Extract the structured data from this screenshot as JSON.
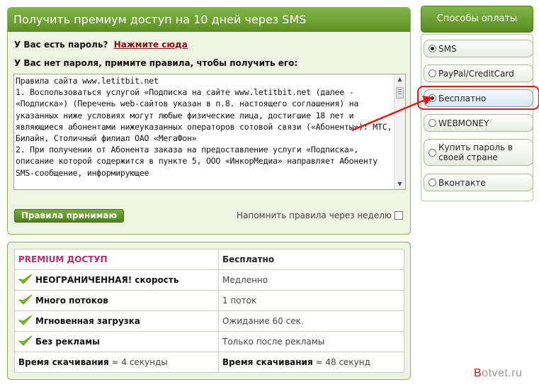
{
  "sms_panel": {
    "title": "Получить премиум доступ на 10 дней через SMS",
    "have_password": "У Вас есть пароль?",
    "click_here": "Нажмите сюда",
    "no_password": "У Вас нет пароля, примите правила, чтобы получить его:",
    "rules_text": "Правила сайта www.letitbit.net\n1. Воспользоваться услугой «Подписка на сайте www.letitbit.net (далее - «Подписка») (Перечень web-сайтов указан в п.8. настоящего соглашения) на указанных ниже условиях могут любые физические лица, достигшие 18 лет и являющиеся абонентами нижеуказанных операторов сотовой связи («Абоненты»): МТС, Билайн, Столичный филиал ОАО «МегаФон»\n2. При получении от Абонента заказа на предоставление услуги «Подписка», описание которой содержится в пункте 5, ООО «ИнкорМедиа» направляет Абоненту SMS-сообщение, информирующее",
    "accept_button": "Правила принимаю",
    "remind_label": "Напомнить правила через неделю"
  },
  "compare_table": {
    "premium_header": "PREMIUM ДОСТУП",
    "free_header": "Бесплатно",
    "rows": [
      {
        "premium": "НЕОГРАНИЧЕННАЯ! скорость",
        "free": "Медленно"
      },
      {
        "premium": "Много потоков",
        "free": "1 поток"
      },
      {
        "premium": "Мгновенная загрузка",
        "free": "Ожидание 60 сек."
      },
      {
        "premium": "Без рекламы",
        "free": "Только после рекламы"
      }
    ],
    "download_label": "Время скачивания",
    "premium_time": "≈ 4 секунды",
    "free_time": "≈ 48 секунд"
  },
  "payment": {
    "header": "Способы оплаты",
    "options": [
      {
        "label": "SMS",
        "selected": false
      },
      {
        "label": "PayPal/CreditCard",
        "selected": false
      },
      {
        "label": "Бесплатно",
        "selected": true
      },
      {
        "label": "WEBMONEY",
        "selected": false
      },
      {
        "label": "Купить пароль в своей стране",
        "selected": false
      },
      {
        "label": "Вконтакте",
        "selected": false
      }
    ]
  },
  "watermark": {
    "prefix": "B",
    "rest": "otvet.ru"
  },
  "colors": {
    "accent_green": "#5d8f24",
    "highlight_red": "#d81d1d",
    "premium_pink": "#b3306c"
  },
  "icons": [
    "check-icon",
    "radio-icon",
    "scroll-up-icon",
    "scroll-down-icon",
    "arrow-annotation"
  ]
}
